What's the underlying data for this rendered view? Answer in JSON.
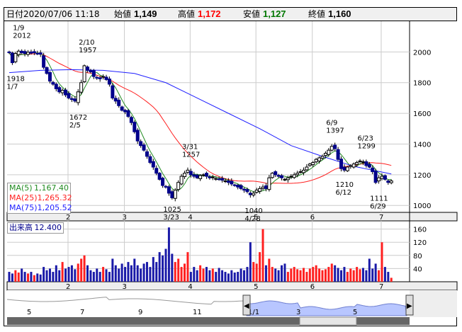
{
  "header": {
    "date_label": "日付",
    "date_value": "2020/07/06 11:18",
    "open_label": "始値",
    "open_value": "1,149",
    "high_label": "高値",
    "high_value": "1,172",
    "low_label": "安値",
    "low_value": "1,127",
    "close_label": "終値",
    "close_value": "1,160"
  },
  "legend": {
    "ma5_label": "MA(5)",
    "ma5_value": "1,167.40",
    "ma25_label": "MA(25)",
    "ma25_value": "1,265.32",
    "ma75_label": "MA(75)",
    "ma75_value": "1,205.52"
  },
  "volume_legend": {
    "label": "出来高",
    "value": "12.400"
  },
  "colors": {
    "up": "#ffffff",
    "down": "#00008b",
    "ma5": "#228b22",
    "ma25": "#ff2020",
    "ma75": "#2020ff",
    "vol_up": "#ff2020",
    "vol_down": "#1a1aa8"
  },
  "navigator": {
    "labels": [
      "5",
      "7",
      "9",
      "11",
      "1/1",
      "3",
      "5"
    ]
  },
  "chart_data": {
    "type": "candlestick",
    "price_ticks": [
      2000,
      1800,
      1600,
      1400,
      1200,
      1000
    ],
    "price_range": [
      955,
      2200
    ],
    "volume_ticks": [
      160,
      120,
      80,
      40
    ],
    "volume_range": [
      0,
      185
    ],
    "month_ticks": [
      {
        "label": "2",
        "index": 19
      },
      {
        "label": "3",
        "index": 37
      },
      {
        "label": "4",
        "index": 58
      },
      {
        "label": "5",
        "index": 79
      },
      {
        "label": "6",
        "index": 97
      },
      {
        "label": "7",
        "index": 119
      }
    ],
    "closes": [
      1995,
      1930,
      1990,
      2005,
      1995,
      1990,
      1998,
      1992,
      1995,
      1990,
      1985,
      1900,
      1860,
      1810,
      1790,
      1760,
      1740,
      1750,
      1720,
      1700,
      1690,
      1680,
      1740,
      1800,
      1910,
      1880,
      1870,
      1840,
      1830,
      1825,
      1840,
      1820,
      1790,
      1700,
      1680,
      1650,
      1620,
      1610,
      1580,
      1540,
      1480,
      1420,
      1390,
      1360,
      1320,
      1280,
      1250,
      1210,
      1170,
      1130,
      1120,
      1080,
      1050,
      1100,
      1150,
      1190,
      1210,
      1230,
      1200,
      1190,
      1180,
      1195,
      1200,
      1190,
      1180,
      1185,
      1175,
      1170,
      1165,
      1160,
      1150,
      1140,
      1130,
      1120,
      1110,
      1100,
      1090,
      1070,
      1080,
      1100,
      1110,
      1120,
      1110,
      1180,
      1210,
      1200,
      1190,
      1180,
      1170,
      1180,
      1190,
      1200,
      1210,
      1220,
      1230,
      1250,
      1270,
      1280,
      1300,
      1310,
      1320,
      1340,
      1360,
      1385,
      1370,
      1300,
      1240,
      1230,
      1250,
      1260,
      1270,
      1280,
      1290,
      1285,
      1260,
      1250,
      1220,
      1150,
      1180,
      1190,
      1170,
      1150,
      1160
    ],
    "volumes": [
      30,
      25,
      35,
      28,
      40,
      30,
      25,
      30,
      20,
      25,
      22,
      45,
      35,
      40,
      30,
      50,
      35,
      60,
      40,
      45,
      50,
      38,
      55,
      70,
      80,
      50,
      35,
      30,
      40,
      30,
      45,
      38,
      30,
      70,
      50,
      40,
      55,
      45,
      60,
      50,
      70,
      50,
      40,
      55,
      60,
      45,
      75,
      60,
      90,
      80,
      100,
      165,
      85,
      60,
      70,
      45,
      55,
      90,
      30,
      45,
      35,
      50,
      40,
      45,
      35,
      40,
      30,
      42,
      35,
      30,
      25,
      35,
      28,
      30,
      40,
      35,
      45,
      120,
      60,
      55,
      90,
      160,
      50,
      70,
      45,
      40,
      35,
      50,
      55,
      30,
      40,
      45,
      38,
      35,
      42,
      30,
      40,
      45,
      50,
      40,
      35,
      38,
      45,
      55,
      50,
      42,
      35,
      45,
      30,
      40,
      35,
      45,
      38,
      42,
      35,
      70,
      40,
      55,
      35,
      120,
      45,
      30,
      12
    ],
    "ma75": [
      [
        0,
        1865
      ],
      [
        10,
        1880
      ],
      [
        20,
        1885
      ],
      [
        30,
        1880
      ],
      [
        40,
        1860
      ],
      [
        50,
        1800
      ],
      [
        60,
        1700
      ],
      [
        70,
        1600
      ],
      [
        80,
        1500
      ],
      [
        90,
        1390
      ],
      [
        100,
        1320
      ],
      [
        110,
        1255
      ],
      [
        122,
        1205
      ]
    ],
    "annotations": [
      {
        "index": 3,
        "date": "1/9",
        "value": "2012",
        "pos": "above"
      },
      {
        "index": 1,
        "date": "1/7",
        "value": "1918",
        "pos": "below"
      },
      {
        "index": 24,
        "date": "2/10",
        "value": "1957",
        "pos": "above"
      },
      {
        "index": 21,
        "date": "2/5",
        "value": "1672",
        "pos": "below"
      },
      {
        "index": 57,
        "date": "3/31",
        "value": "1257",
        "pos": "above"
      },
      {
        "index": 51,
        "date": "3/23",
        "value": "1025",
        "pos": "below"
      },
      {
        "index": 77,
        "date": "4/28",
        "value": "1040",
        "pos": "below"
      },
      {
        "index": 103,
        "date": "6/9",
        "value": "1397",
        "pos": "above"
      },
      {
        "index": 106,
        "date": "6/12",
        "value": "1210",
        "pos": "below"
      },
      {
        "index": 113,
        "date": "6/23",
        "value": "1299",
        "pos": "above"
      },
      {
        "index": 117,
        "date": "6/29",
        "value": "1111",
        "pos": "below"
      }
    ]
  }
}
